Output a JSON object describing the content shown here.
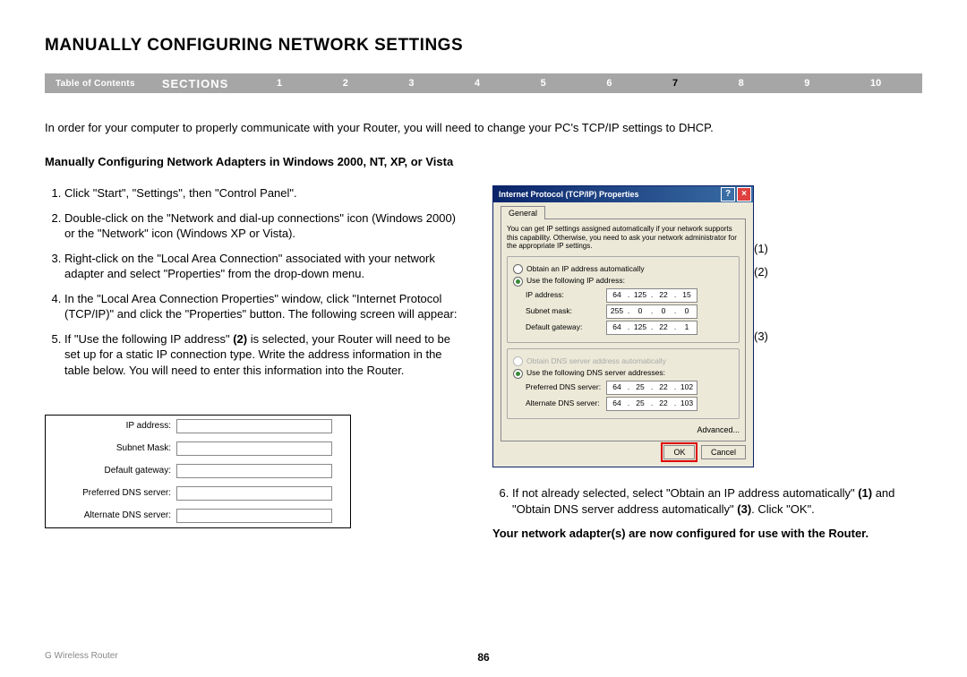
{
  "title": "MANUALLY CONFIGURING NETWORK SETTINGS",
  "nav": {
    "toc": "Table of Contents",
    "sections_label": "SECTIONS",
    "items": [
      "1",
      "2",
      "3",
      "4",
      "5",
      "6",
      "7",
      "8",
      "9",
      "10"
    ],
    "active": "7"
  },
  "intro": "In order for your computer to properly communicate with your Router, you will need to change your PC's TCP/IP settings to DHCP.",
  "subheader": "Manually Configuring Network Adapters in Windows 2000, NT, XP, or Vista",
  "steps": {
    "s1": "Click \"Start\", \"Settings\", then \"Control Panel\".",
    "s2": "Double-click on the \"Network and dial-up connections\" icon (Windows 2000) or the \"Network\" icon (Windows XP or Vista).",
    "s3": "Right-click on the \"Local Area Connection\" associated with your network adapter and select \"Properties\" from the drop-down menu.",
    "s4": "In the \"Local Area Connection Properties\" window, click \"Internet Protocol (TCP/IP)\" and click the \"Properties\" button. The following screen will appear:",
    "s5a": "If \"Use the following IP address\" ",
    "s5b": "(2)",
    "s5c": " is selected, your Router will need to be set up for a static IP connection type. Write the address information in the table below. You will need to enter this information into the Router.",
    "s6a": "If not already selected, select \"Obtain an IP address automatically\" ",
    "s6b": "(1)",
    "s6c": " and \"Obtain DNS server address automatically\" ",
    "s6d": "(3)",
    "s6e": ". Click \"OK\"."
  },
  "ip_table": {
    "r1": "IP address:",
    "r2": "Subnet Mask:",
    "r3": "Default gateway:",
    "r4": "Preferred DNS server:",
    "r5": "Alternate DNS server:"
  },
  "dialog": {
    "title": "Internet Protocol (TCP/IP) Properties",
    "tab": "General",
    "desc": "You can get IP settings assigned automatically if your network supports this capability. Otherwise, you need to ask your network administrator for the appropriate IP settings.",
    "r_auto_ip": "Obtain an IP address automatically",
    "r_use_ip": "Use the following IP address:",
    "ip_label": "IP address:",
    "ip_val": [
      "64",
      "125",
      "22",
      "15"
    ],
    "mask_label": "Subnet mask:",
    "mask_val": [
      "255",
      "0",
      "0",
      "0"
    ],
    "gw_label": "Default gateway:",
    "gw_val": [
      "64",
      "125",
      "22",
      "1"
    ],
    "r_auto_dns": "Obtain DNS server address automatically",
    "r_use_dns": "Use the following DNS server addresses:",
    "pdns_label": "Preferred DNS server:",
    "pdns_val": [
      "64",
      "25",
      "22",
      "102"
    ],
    "adns_label": "Alternate DNS server:",
    "adns_val": [
      "64",
      "25",
      "22",
      "103"
    ],
    "advanced": "Advanced...",
    "ok": "OK",
    "cancel": "Cancel"
  },
  "callouts": {
    "c1": "(1)",
    "c2": "(2)",
    "c3": "(3)"
  },
  "right_note": "Your network adapter(s) are now configured for use with the Router.",
  "footer": {
    "product": "G Wireless Router",
    "page": "86"
  }
}
